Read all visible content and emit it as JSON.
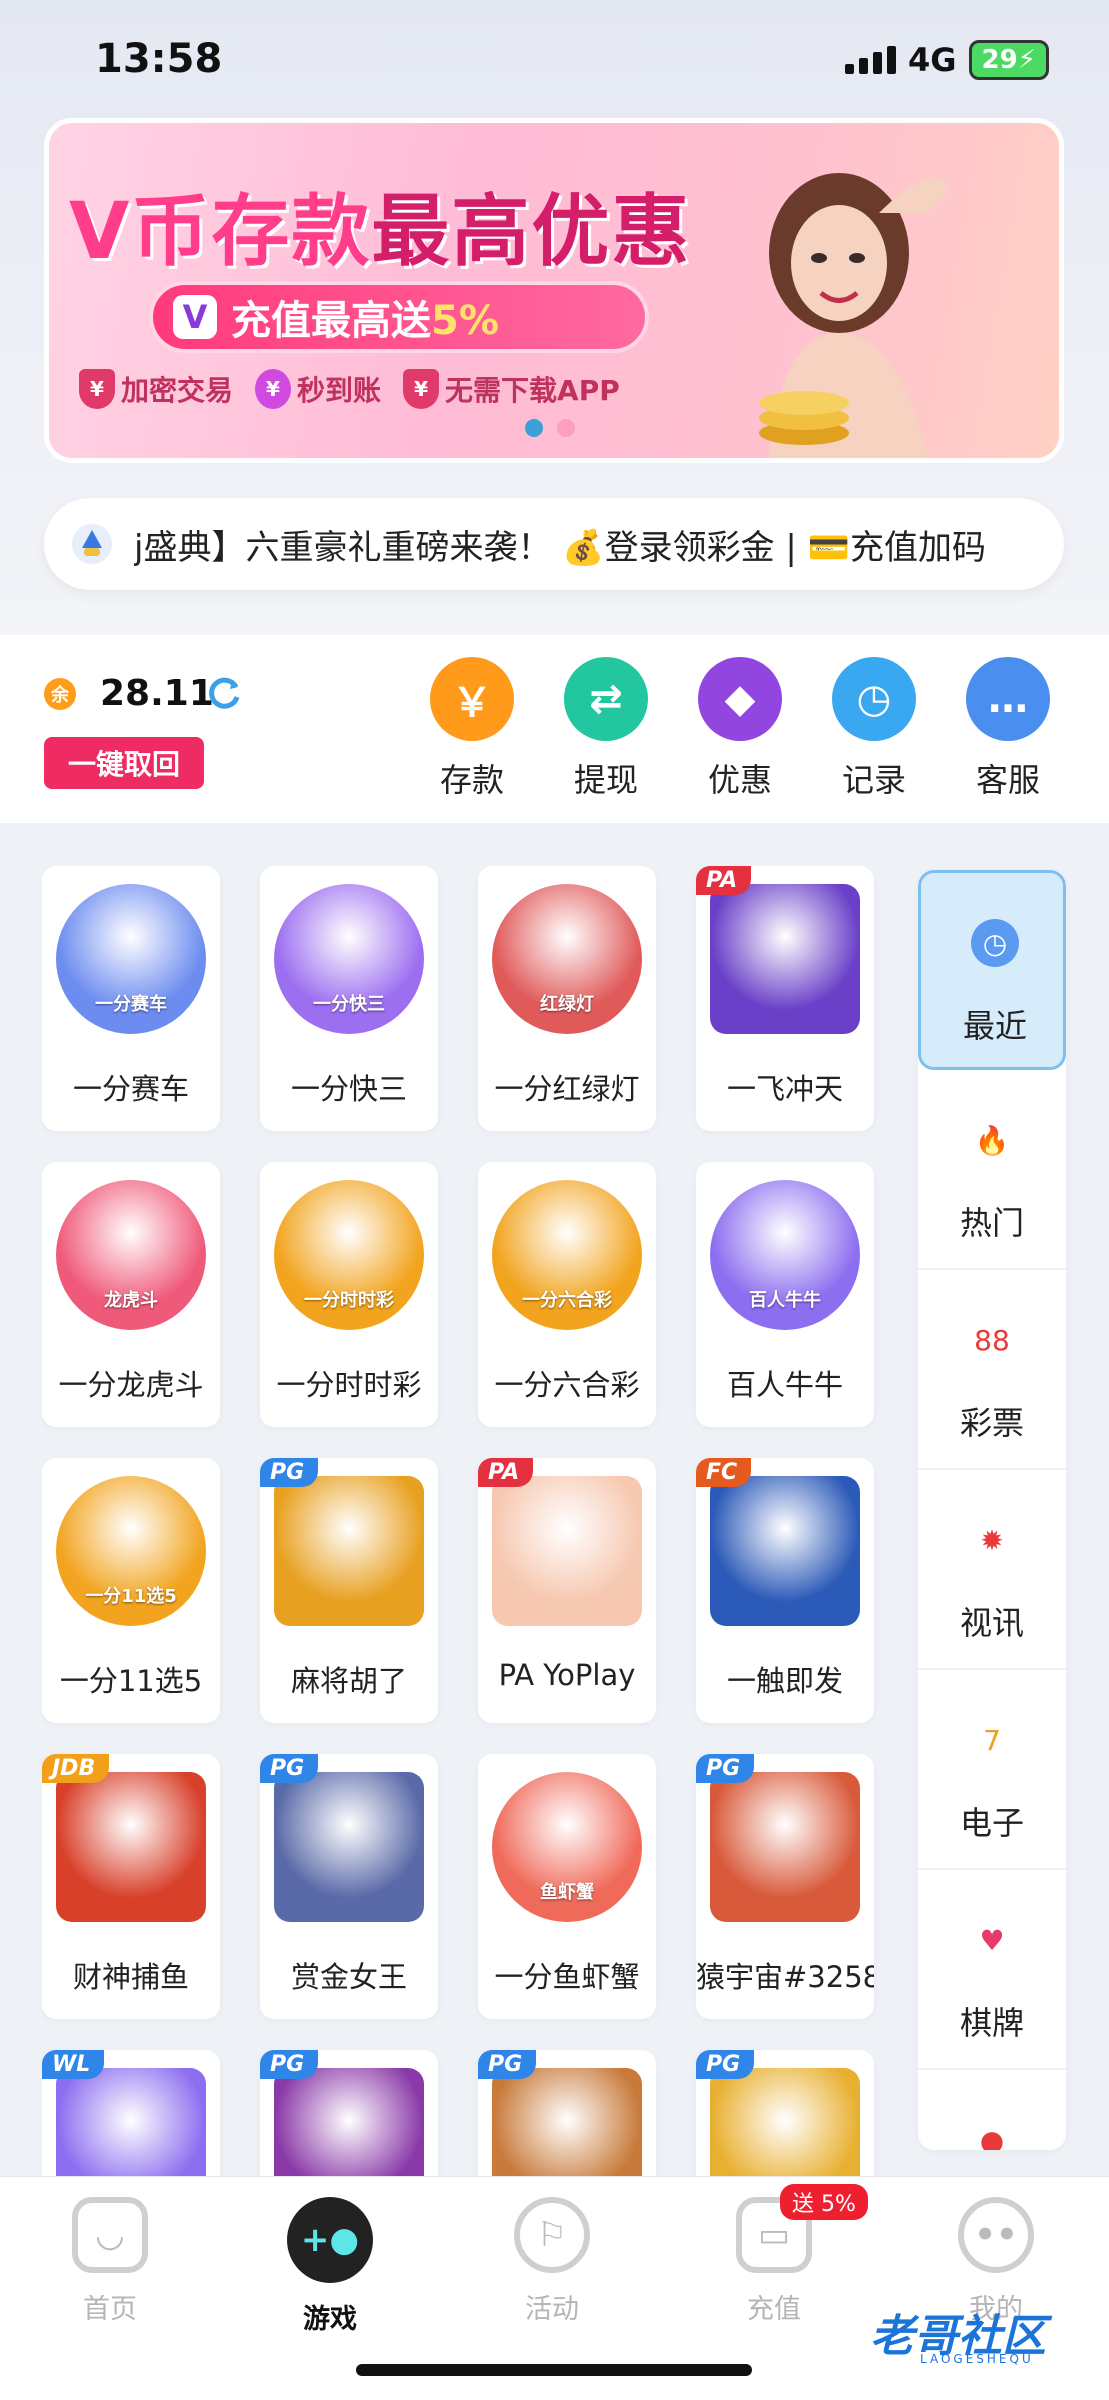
{
  "status": {
    "time": "13:58",
    "network": "4G",
    "battery": "29"
  },
  "banner": {
    "title_a": "V币存款",
    "title_b": "最高优惠",
    "pill_icon": "V",
    "pill_text": "充值最高送",
    "pill_pct": "5%",
    "features": [
      "加密交易",
      "秒到账",
      "无需下载APP"
    ],
    "feature_icons": [
      "yen-shield-icon",
      "yen-clock-icon",
      "yen-shield-icon"
    ]
  },
  "marquee": {
    "text": "j盛典】六重豪礼重磅来袭！ 💰登录领彩金 | 💳充值加码"
  },
  "wallet": {
    "currency_icon": "余",
    "balance": "28.11",
    "withdraw_all": "一键取回",
    "actions": [
      {
        "label": "存款",
        "icon": "￥",
        "color": "#ff9a1a"
      },
      {
        "label": "提现",
        "icon": "⇄",
        "color": "#22c7a0"
      },
      {
        "label": "优惠",
        "icon": "◆",
        "color": "#9246e0"
      },
      {
        "label": "记录",
        "icon": "◷",
        "color": "#3aa8f0"
      },
      {
        "label": "客服",
        "icon": "…",
        "color": "#4a8ef0"
      }
    ]
  },
  "games": [
    {
      "name": "一分赛车",
      "caption": "一分赛车",
      "badge": "",
      "bg": "#6c8cf0"
    },
    {
      "name": "一分快三",
      "caption": "一分快三",
      "badge": "",
      "bg": "#9c6ef0"
    },
    {
      "name": "一分红绿灯",
      "caption": "红绿灯",
      "badge": "",
      "bg": "#e05a5a"
    },
    {
      "name": "一飞冲天",
      "caption": "",
      "badge": "PA",
      "bg": "#6a40c8"
    },
    {
      "name": "一分龙虎斗",
      "caption": "龙虎斗",
      "badge": "",
      "bg": "#f05a7a"
    },
    {
      "name": "一分时时彩",
      "caption": "一分时时彩",
      "badge": "",
      "bg": "#f2a41e"
    },
    {
      "name": "一分六合彩",
      "caption": "一分六合彩",
      "badge": "",
      "bg": "#f2a41e"
    },
    {
      "name": "百人牛牛",
      "caption": "百人牛牛",
      "badge": "",
      "bg": "#8c6ef0"
    },
    {
      "name": "一分11选5",
      "caption": "一分11选5",
      "badge": "",
      "bg": "#f2a41e"
    },
    {
      "name": "麻将胡了",
      "caption": "",
      "badge": "PG",
      "bg": "#e8a020"
    },
    {
      "name": "PA YoPlay",
      "caption": "",
      "badge": "PA",
      "bg": "#f6c8b0"
    },
    {
      "name": "一触即发",
      "caption": "",
      "badge": "FC",
      "bg": "#2c5ab8"
    },
    {
      "name": "财神捕鱼",
      "caption": "",
      "badge": "JDB",
      "bg": "#d8402a"
    },
    {
      "name": "赏金女王",
      "caption": "",
      "badge": "PG",
      "bg": "#5a6aa8"
    },
    {
      "name": "一分鱼虾蟹",
      "caption": "鱼虾蟹",
      "badge": "",
      "bg": "#f06a5a"
    },
    {
      "name": "猿宇宙#3258",
      "caption": "",
      "badge": "PG",
      "bg": "#d85a3a"
    },
    {
      "name": "",
      "caption": "",
      "badge": "WL",
      "bg": "#8c6ef0"
    },
    {
      "name": "",
      "caption": "",
      "badge": "PG",
      "bg": "#8a3aa8"
    },
    {
      "name": "",
      "caption": "",
      "badge": "PG",
      "bg": "#c87a3a"
    },
    {
      "name": "",
      "caption": "",
      "badge": "PG",
      "bg": "#e8b030"
    }
  ],
  "categories": [
    {
      "label": "最近",
      "icon": "clock-icon",
      "glyph": "◷",
      "color": "#5a9af0"
    },
    {
      "label": "热门",
      "icon": "flame-icon",
      "glyph": "🔥",
      "color": "#ff7a2a"
    },
    {
      "label": "彩票",
      "icon": "lottery-ball-icon",
      "glyph": "88",
      "color": "#e83a3a"
    },
    {
      "label": "视讯",
      "icon": "casino-chip-icon",
      "glyph": "✹",
      "color": "#e83a3a"
    },
    {
      "label": "电子",
      "icon": "slot-seven-icon",
      "glyph": "7",
      "color": "#f0a020"
    },
    {
      "label": "棋牌",
      "icon": "playing-cards-icon",
      "glyph": "♥",
      "color": "#e83a6a"
    },
    {
      "label": "",
      "icon": "fish-icon",
      "glyph": "●",
      "color": "#e83a3a"
    }
  ],
  "bottom_nav": [
    {
      "label": "首页",
      "icon": "home-icon",
      "glyph": "◡"
    },
    {
      "label": "游戏",
      "icon": "gamepad-icon",
      "glyph": "+●"
    },
    {
      "label": "活动",
      "icon": "flag-icon",
      "glyph": "⚐"
    },
    {
      "label": "充值",
      "icon": "wallet-icon",
      "glyph": "▭"
    },
    {
      "label": "我的",
      "icon": "profile-face-icon",
      "glyph": "••"
    }
  ],
  "promo_badge": "送 5%",
  "watermark": {
    "title": "老哥社区",
    "sub": "LAOGESHEQU"
  }
}
